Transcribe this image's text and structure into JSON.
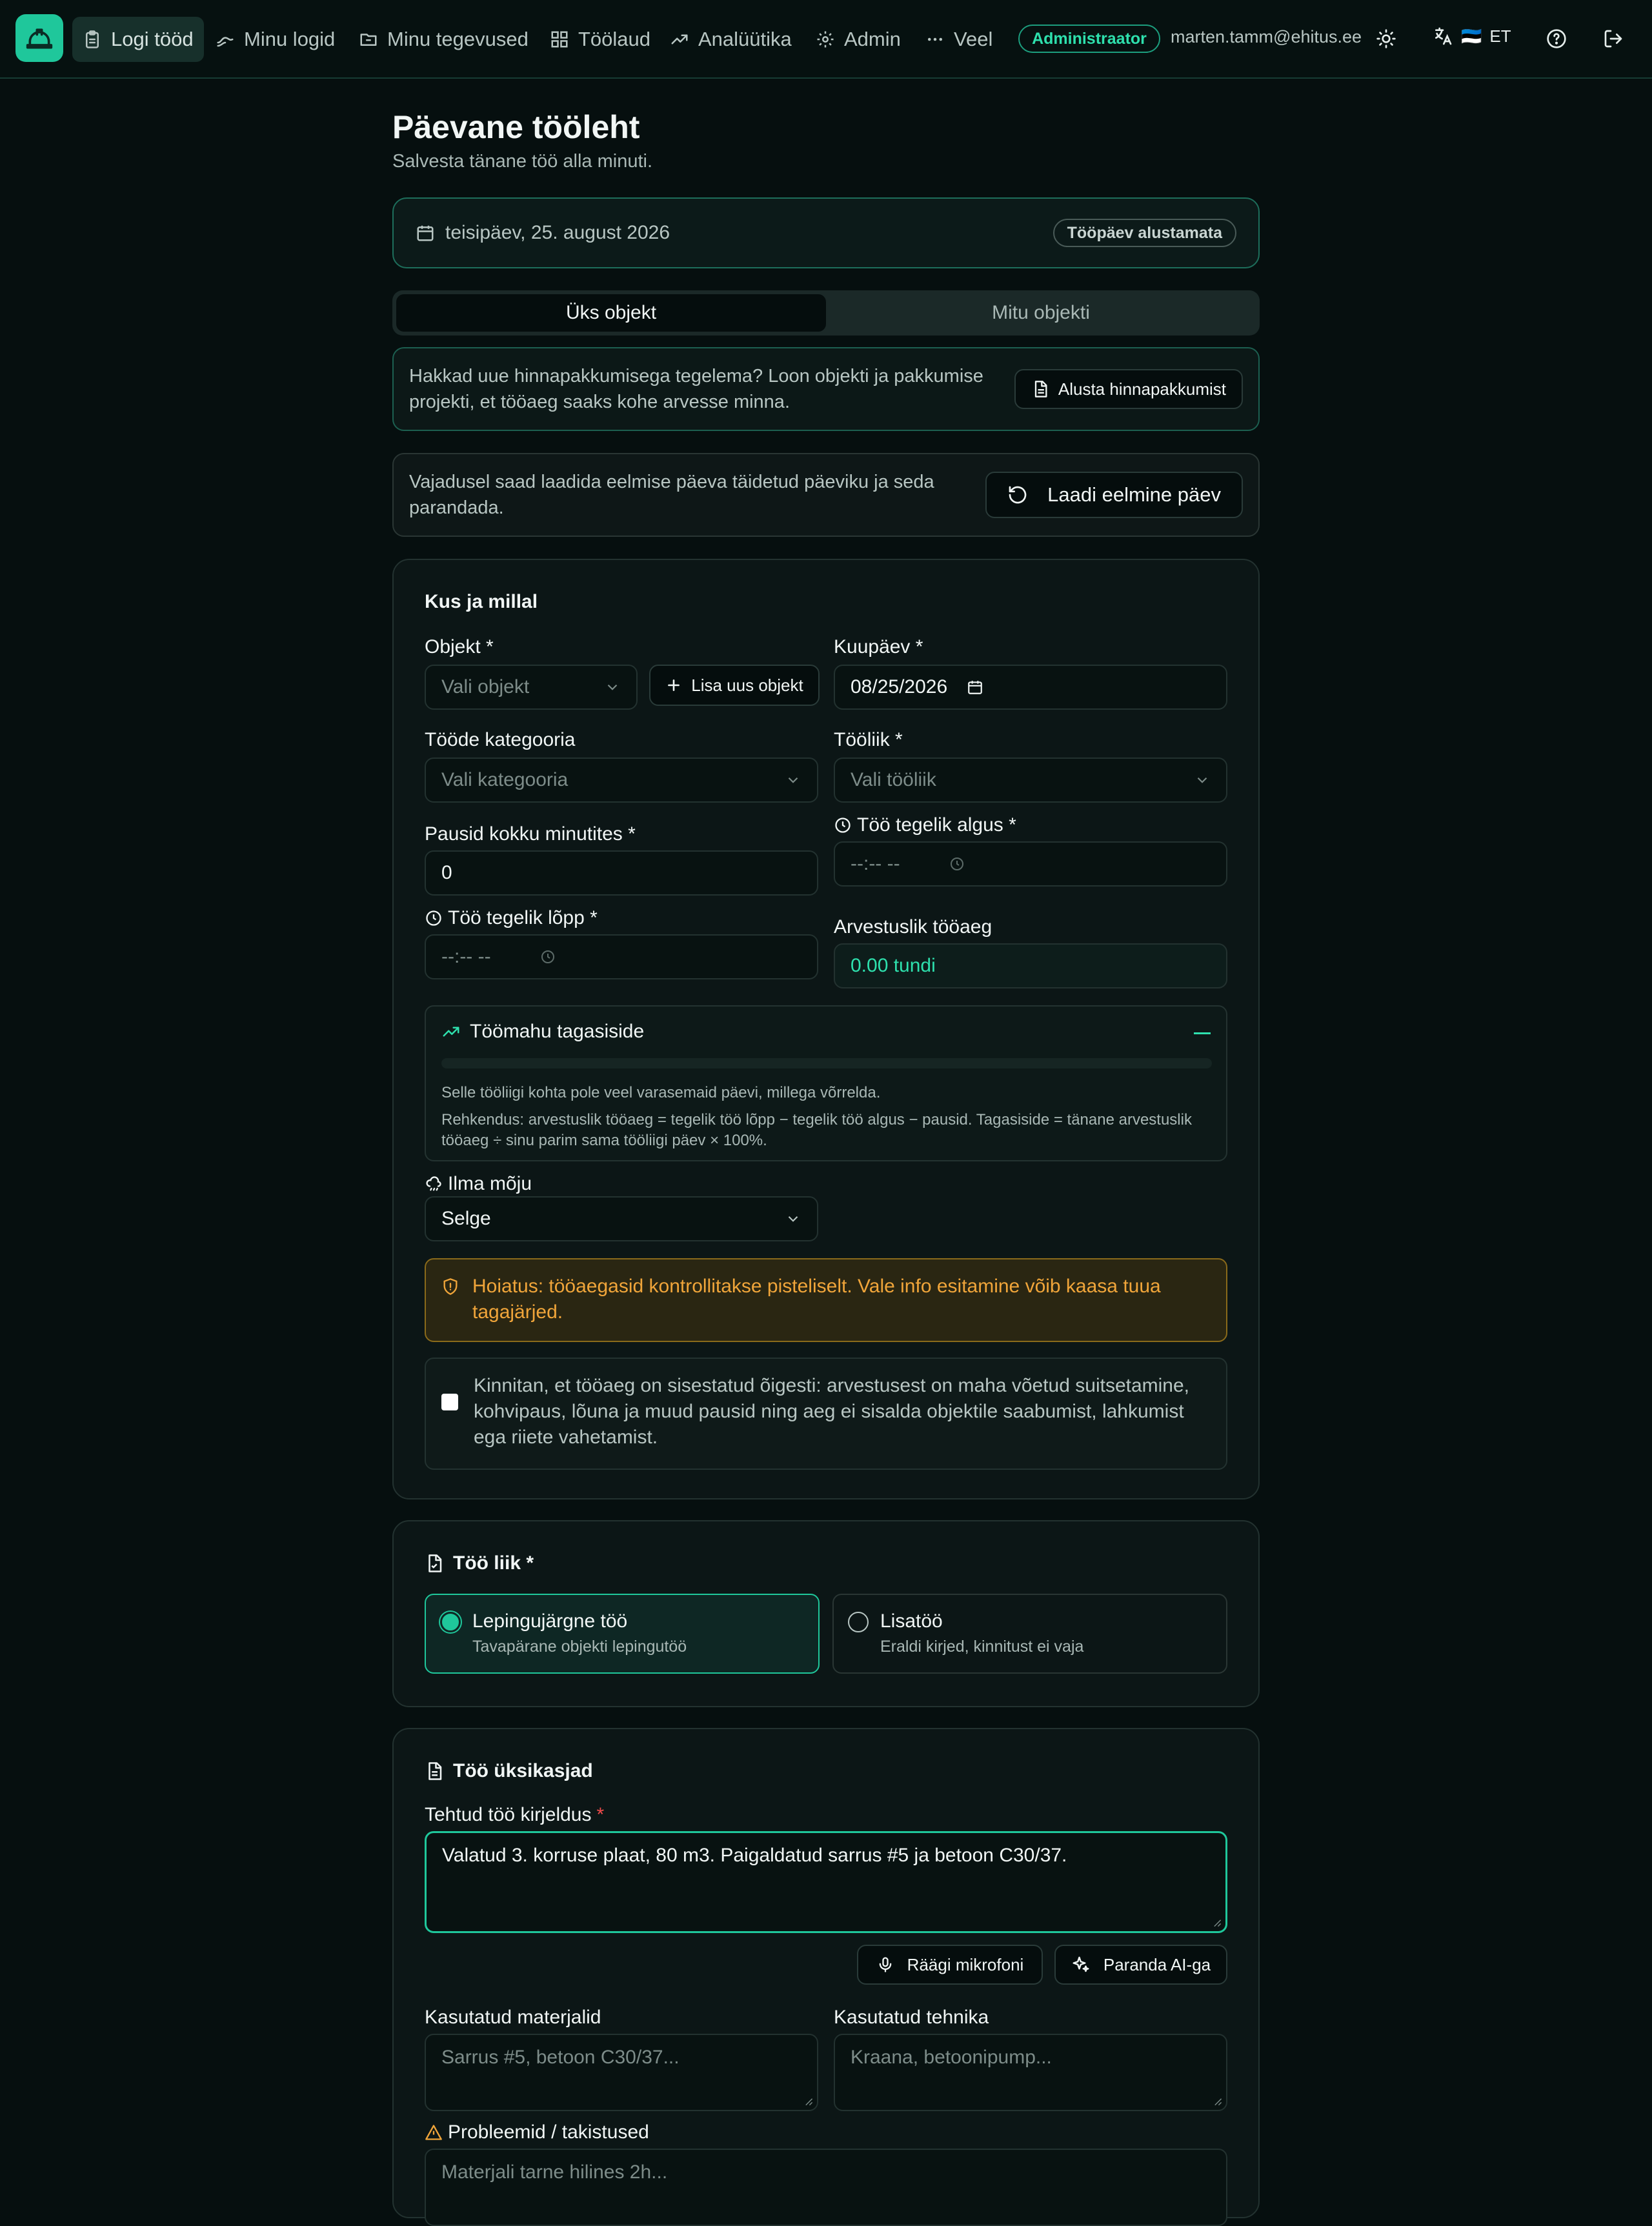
{
  "nav": {
    "items": [
      {
        "label": "Logi tööd",
        "icon": "clipboard-icon",
        "active": true
      },
      {
        "label": "Minu logid",
        "icon": "trend-icon"
      },
      {
        "label": "Minu tegevused",
        "icon": "folder-icon"
      },
      {
        "label": "Töölaud",
        "icon": "grid-icon"
      },
      {
        "label": "Analüütika",
        "icon": "analytics-icon"
      },
      {
        "label": "Admin",
        "icon": "gear-icon"
      },
      {
        "label": "Veel",
        "icon": "dots-icon"
      }
    ],
    "role_badge": "Administraator",
    "user_email": "marten.tamm@ehitus.ee",
    "lang_flag": "🇪🇪",
    "lang_code": "ET"
  },
  "page": {
    "title": "Päevane tööleht",
    "subtitle": "Salvesta tänane töö alla minuti."
  },
  "date_bar": {
    "date": "teisipäev, 25. august 2026",
    "status": "Tööpäev alustamata"
  },
  "mode_tabs": [
    {
      "label": "Üks objekt",
      "active": true
    },
    {
      "label": "Mitu objekti",
      "active": false
    }
  ],
  "quote_info": {
    "text": "Hakkad uue hinnapakkumisega tegelema? Loon objekti ja pakkumise projekti, et tööaeg saaks kohe arvesse minna.",
    "button": "Alusta hinnapakkumist"
  },
  "previous_day": {
    "text": "Vajadusel saad laadida eelmise päeva täidetud päeviku ja seda parandada.",
    "button": "Laadi eelmine päev"
  },
  "where_when": {
    "heading": "Kus ja millal",
    "object_label": "Objekt *",
    "object_placeholder": "Vali objekt",
    "add_object_button": "Lisa uus objekt",
    "date_label": "Kuupäev *",
    "date_value": "08/25/2026",
    "category_label": "Tööde kategooria",
    "category_placeholder": "Vali kategooria",
    "worktype_label": "Tööliik *",
    "worktype_placeholder": "Vali tööliik",
    "breaks_label": "Pausid kokku minutites *",
    "breaks_value": "0",
    "start_label": "Töö tegelik algus *",
    "start_value": "--:-- --",
    "end_label": "Töö tegelik lõpp *",
    "end_value": "--:-- --",
    "billable_label": "Arvestuslik tööaeg",
    "billable_value": "0.00 tundi",
    "feedback": {
      "heading": "Töömahu tagasiside",
      "progress_fraction": 0,
      "line1": "Selle tööliigi kohta pole veel varasemaid päevi, millega võrrelda.",
      "line2": "Rehkendus: arvestuslik tööaeg = tegelik töö lõpp − tegelik töö algus − pausid. Tagasiside = tänane arvestuslik tööaeg ÷ sinu parim sama tööliigi päev × 100%."
    },
    "weather_label": "Ilma mõju",
    "weather_value": "Selge",
    "warning": "Hoiatus: tööaegasid kontrollitakse pisteliselt. Vale info esitamine võib kaasa tuua tagajärjed.",
    "confirm_text": "Kinnitan, et tööaeg on sisestatud õigesti: arvestusest on maha võetud suitsetamine, kohvipaus, lõuna ja muud pausid ning aeg ei sisalda objektile saabumist, lahkumist ega riiete vahetamist.",
    "confirm_checked": false
  },
  "work_kind": {
    "heading": "Töö liik *",
    "options": [
      {
        "title": "Lepingujärgne töö",
        "subtitle": "Tavapärane objekti lepingutöö",
        "selected": true
      },
      {
        "title": "Lisatöö",
        "subtitle": "Eraldi kirjed, kinnitust ei vaja",
        "selected": false
      }
    ]
  },
  "details": {
    "heading": "Töö üksikasjad",
    "description_label": "Tehtud töö kirjeldus",
    "required_mark": "*",
    "description_value": "Valatud 3. korruse plaat, 80 m3. Paigaldatud sarrus #5 ja betoon C30/37.",
    "mic_button": "Räägi mikrofoni",
    "ai_button": "Paranda AI-ga",
    "materials_label": "Kasutatud materjalid",
    "materials_placeholder": "Sarrus #5, betoon C30/37...",
    "equipment_label": "Kasutatud tehnika",
    "equipment_placeholder": "Kraana, betoonipump...",
    "problems_label": "Probleemid / takistused",
    "problems_placeholder": "Materjali tarne hilines 2h..."
  },
  "colors": {
    "accent": "#1fc79b",
    "accent_text": "#2ee0ad",
    "warning": "#f0a53a",
    "background": "#060f0f"
  }
}
